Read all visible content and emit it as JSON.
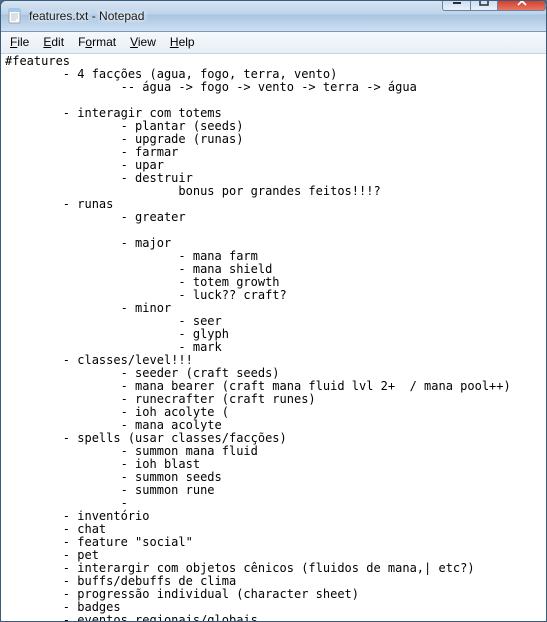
{
  "window": {
    "title": "features.txt - Notepad"
  },
  "menu": {
    "file": {
      "hotkey": "F",
      "rest": "ile"
    },
    "edit": {
      "hotkey": "E",
      "rest": "dit"
    },
    "format": {
      "hotkey": "o",
      "pre": "F",
      "rest": "rmat"
    },
    "view": {
      "hotkey": "V",
      "rest": "iew"
    },
    "help": {
      "hotkey": "H",
      "rest": "elp"
    }
  },
  "icons": {
    "app": "notepad-icon",
    "min": "minimize-icon",
    "max": "maximize-icon",
    "close": "close-icon"
  },
  "document": {
    "lines": [
      "#features",
      "        - 4 facções (agua, fogo, terra, vento)",
      "                -- água -> fogo -> vento -> terra -> água",
      "",
      "        - interagir com totems",
      "                - plantar (seeds)",
      "                - upgrade (runas)",
      "                - farmar",
      "                - upar",
      "                - destruir",
      "                        bonus por grandes feitos!!!?",
      "        - runas",
      "                - greater",
      "",
      "                - major",
      "                        - mana farm",
      "                        - mana shield",
      "                        - totem growth",
      "                        - luck?? craft?",
      "                - minor",
      "                        - seer",
      "                        - glyph",
      "                        - mark",
      "        - classes/level!!!",
      "                - seeder (craft seeds)",
      "                - mana bearer (craft mana fluid lvl 2+  / mana pool++)",
      "                - runecrafter (craft runes)",
      "                - ioh acolyte (",
      "                - mana acolyte",
      "        - spells (usar classes/facções)",
      "                - summon mana fluid",
      "                - ioh blast",
      "                - summon seeds",
      "                - summon rune",
      "                -",
      "        - inventório",
      "        - chat",
      "        - feature \"social\"",
      "        - pet",
      "        - interargir com objetos cênicos (fluidos de mana,| etc?)",
      "        - buffs/debuffs de clima",
      "        - progressão individual (character sheet)",
      "        - badges",
      "        - eventos regionais/globais"
    ]
  }
}
